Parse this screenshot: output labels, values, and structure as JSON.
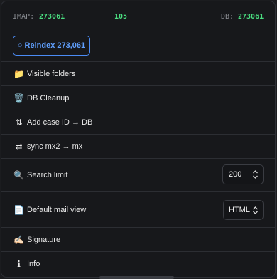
{
  "stats": {
    "imap_label": "IMAP:",
    "imap_value": "273061",
    "diff_value": "105",
    "db_label": "DB:",
    "db_value": "273061"
  },
  "reindex": {
    "icon": "refresh-icon",
    "glyph": "○",
    "label": "Reindex 273,061"
  },
  "menu": {
    "visible_folders": {
      "icon": "folder-icon",
      "glyph": "📁",
      "label": "Visible folders"
    },
    "db_cleanup": {
      "icon": "trash-icon",
      "glyph": "🗑️",
      "label": "DB Cleanup"
    },
    "add_case_id": {
      "icon": "arrows-updown-icon",
      "glyph": "⇅",
      "label": "Add case ID → DB"
    },
    "sync": {
      "icon": "arrows-swap-icon",
      "glyph": "⇄",
      "label": "sync mx2 → mx"
    },
    "search_limit": {
      "icon": "magnifier-icon",
      "glyph": "🔍",
      "label": "Search limit",
      "value": "200"
    },
    "default_view": {
      "icon": "document-icon",
      "glyph": "📄",
      "label": "Default mail view",
      "value": "HTML"
    },
    "signature": {
      "icon": "signature-icon",
      "glyph": "✍🏻",
      "label": "Signature"
    },
    "info": {
      "icon": "info-icon",
      "glyph": "ℹ",
      "label": "Info"
    }
  },
  "colors": {
    "accent": "#4b8bf5",
    "green": "#4ade80",
    "background": "#17181b"
  }
}
